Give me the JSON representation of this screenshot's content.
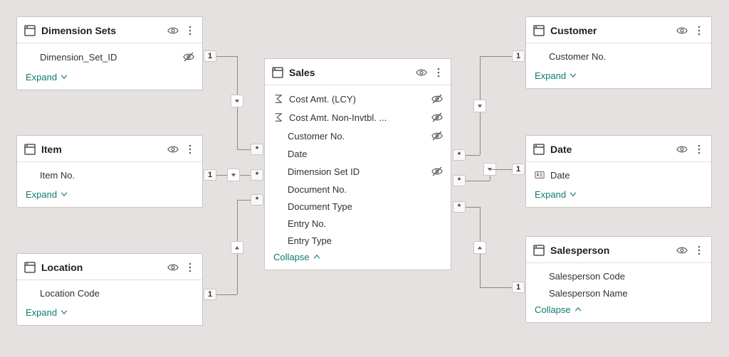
{
  "labels": {
    "expand": "Expand",
    "collapse": "Collapse"
  },
  "rel": {
    "one": "1",
    "many": "*"
  },
  "tables": {
    "dimension_sets": {
      "title": "Dimension Sets",
      "fields": {
        "dimension_set_id": "Dimension_Set_ID"
      }
    },
    "item": {
      "title": "Item",
      "fields": {
        "item_no": "Item No."
      }
    },
    "location": {
      "title": "Location",
      "fields": {
        "location_code": "Location Code"
      }
    },
    "sales": {
      "title": "Sales",
      "fields": {
        "cost_amt_lcy": "Cost Amt. (LCY)",
        "cost_amt_non_invtbl": "Cost Amt. Non-Invtbl. ...",
        "customer_no": "Customer No.",
        "date": "Date",
        "dimension_set_id": "Dimension Set ID",
        "document_no": "Document No.",
        "document_type": "Document Type",
        "entry_no": "Entry No.",
        "entry_type": "Entry Type"
      }
    },
    "customer": {
      "title": "Customer",
      "fields": {
        "customer_no": "Customer No."
      }
    },
    "date": {
      "title": "Date",
      "fields": {
        "date": "Date"
      }
    },
    "salesperson": {
      "title": "Salesperson",
      "fields": {
        "salesperson_code": "Salesperson Code",
        "salesperson_name": "Salesperson Name"
      }
    }
  }
}
